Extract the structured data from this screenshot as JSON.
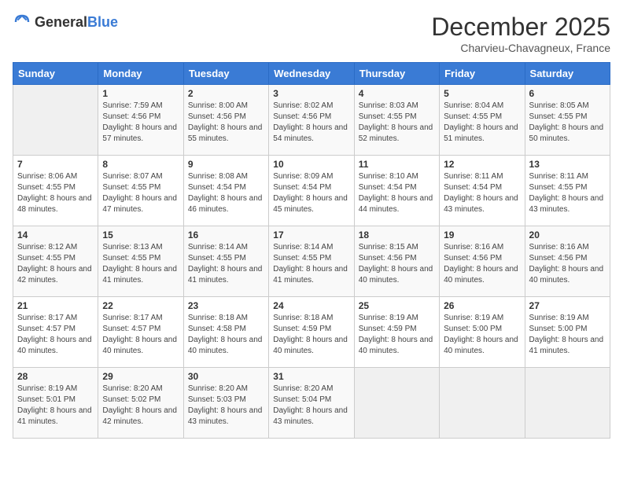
{
  "header": {
    "logo_general": "General",
    "logo_blue": "Blue",
    "month_year": "December 2025",
    "location": "Charvieu-Chavagneux, France"
  },
  "weekdays": [
    "Sunday",
    "Monday",
    "Tuesday",
    "Wednesday",
    "Thursday",
    "Friday",
    "Saturday"
  ],
  "weeks": [
    [
      {
        "day": "",
        "sunrise": "",
        "sunset": "",
        "daylight": ""
      },
      {
        "day": "1",
        "sunrise": "Sunrise: 7:59 AM",
        "sunset": "Sunset: 4:56 PM",
        "daylight": "Daylight: 8 hours and 57 minutes."
      },
      {
        "day": "2",
        "sunrise": "Sunrise: 8:00 AM",
        "sunset": "Sunset: 4:56 PM",
        "daylight": "Daylight: 8 hours and 55 minutes."
      },
      {
        "day": "3",
        "sunrise": "Sunrise: 8:02 AM",
        "sunset": "Sunset: 4:56 PM",
        "daylight": "Daylight: 8 hours and 54 minutes."
      },
      {
        "day": "4",
        "sunrise": "Sunrise: 8:03 AM",
        "sunset": "Sunset: 4:55 PM",
        "daylight": "Daylight: 8 hours and 52 minutes."
      },
      {
        "day": "5",
        "sunrise": "Sunrise: 8:04 AM",
        "sunset": "Sunset: 4:55 PM",
        "daylight": "Daylight: 8 hours and 51 minutes."
      },
      {
        "day": "6",
        "sunrise": "Sunrise: 8:05 AM",
        "sunset": "Sunset: 4:55 PM",
        "daylight": "Daylight: 8 hours and 50 minutes."
      }
    ],
    [
      {
        "day": "7",
        "sunrise": "Sunrise: 8:06 AM",
        "sunset": "Sunset: 4:55 PM",
        "daylight": "Daylight: 8 hours and 48 minutes."
      },
      {
        "day": "8",
        "sunrise": "Sunrise: 8:07 AM",
        "sunset": "Sunset: 4:55 PM",
        "daylight": "Daylight: 8 hours and 47 minutes."
      },
      {
        "day": "9",
        "sunrise": "Sunrise: 8:08 AM",
        "sunset": "Sunset: 4:54 PM",
        "daylight": "Daylight: 8 hours and 46 minutes."
      },
      {
        "day": "10",
        "sunrise": "Sunrise: 8:09 AM",
        "sunset": "Sunset: 4:54 PM",
        "daylight": "Daylight: 8 hours and 45 minutes."
      },
      {
        "day": "11",
        "sunrise": "Sunrise: 8:10 AM",
        "sunset": "Sunset: 4:54 PM",
        "daylight": "Daylight: 8 hours and 44 minutes."
      },
      {
        "day": "12",
        "sunrise": "Sunrise: 8:11 AM",
        "sunset": "Sunset: 4:54 PM",
        "daylight": "Daylight: 8 hours and 43 minutes."
      },
      {
        "day": "13",
        "sunrise": "Sunrise: 8:11 AM",
        "sunset": "Sunset: 4:55 PM",
        "daylight": "Daylight: 8 hours and 43 minutes."
      }
    ],
    [
      {
        "day": "14",
        "sunrise": "Sunrise: 8:12 AM",
        "sunset": "Sunset: 4:55 PM",
        "daylight": "Daylight: 8 hours and 42 minutes."
      },
      {
        "day": "15",
        "sunrise": "Sunrise: 8:13 AM",
        "sunset": "Sunset: 4:55 PM",
        "daylight": "Daylight: 8 hours and 41 minutes."
      },
      {
        "day": "16",
        "sunrise": "Sunrise: 8:14 AM",
        "sunset": "Sunset: 4:55 PM",
        "daylight": "Daylight: 8 hours and 41 minutes."
      },
      {
        "day": "17",
        "sunrise": "Sunrise: 8:14 AM",
        "sunset": "Sunset: 4:55 PM",
        "daylight": "Daylight: 8 hours and 41 minutes."
      },
      {
        "day": "18",
        "sunrise": "Sunrise: 8:15 AM",
        "sunset": "Sunset: 4:56 PM",
        "daylight": "Daylight: 8 hours and 40 minutes."
      },
      {
        "day": "19",
        "sunrise": "Sunrise: 8:16 AM",
        "sunset": "Sunset: 4:56 PM",
        "daylight": "Daylight: 8 hours and 40 minutes."
      },
      {
        "day": "20",
        "sunrise": "Sunrise: 8:16 AM",
        "sunset": "Sunset: 4:56 PM",
        "daylight": "Daylight: 8 hours and 40 minutes."
      }
    ],
    [
      {
        "day": "21",
        "sunrise": "Sunrise: 8:17 AM",
        "sunset": "Sunset: 4:57 PM",
        "daylight": "Daylight: 8 hours and 40 minutes."
      },
      {
        "day": "22",
        "sunrise": "Sunrise: 8:17 AM",
        "sunset": "Sunset: 4:57 PM",
        "daylight": "Daylight: 8 hours and 40 minutes."
      },
      {
        "day": "23",
        "sunrise": "Sunrise: 8:18 AM",
        "sunset": "Sunset: 4:58 PM",
        "daylight": "Daylight: 8 hours and 40 minutes."
      },
      {
        "day": "24",
        "sunrise": "Sunrise: 8:18 AM",
        "sunset": "Sunset: 4:59 PM",
        "daylight": "Daylight: 8 hours and 40 minutes."
      },
      {
        "day": "25",
        "sunrise": "Sunrise: 8:19 AM",
        "sunset": "Sunset: 4:59 PM",
        "daylight": "Daylight: 8 hours and 40 minutes."
      },
      {
        "day": "26",
        "sunrise": "Sunrise: 8:19 AM",
        "sunset": "Sunset: 5:00 PM",
        "daylight": "Daylight: 8 hours and 40 minutes."
      },
      {
        "day": "27",
        "sunrise": "Sunrise: 8:19 AM",
        "sunset": "Sunset: 5:00 PM",
        "daylight": "Daylight: 8 hours and 41 minutes."
      }
    ],
    [
      {
        "day": "28",
        "sunrise": "Sunrise: 8:19 AM",
        "sunset": "Sunset: 5:01 PM",
        "daylight": "Daylight: 8 hours and 41 minutes."
      },
      {
        "day": "29",
        "sunrise": "Sunrise: 8:20 AM",
        "sunset": "Sunset: 5:02 PM",
        "daylight": "Daylight: 8 hours and 42 minutes."
      },
      {
        "day": "30",
        "sunrise": "Sunrise: 8:20 AM",
        "sunset": "Sunset: 5:03 PM",
        "daylight": "Daylight: 8 hours and 43 minutes."
      },
      {
        "day": "31",
        "sunrise": "Sunrise: 8:20 AM",
        "sunset": "Sunset: 5:04 PM",
        "daylight": "Daylight: 8 hours and 43 minutes."
      },
      {
        "day": "",
        "sunrise": "",
        "sunset": "",
        "daylight": ""
      },
      {
        "day": "",
        "sunrise": "",
        "sunset": "",
        "daylight": ""
      },
      {
        "day": "",
        "sunrise": "",
        "sunset": "",
        "daylight": ""
      }
    ]
  ]
}
